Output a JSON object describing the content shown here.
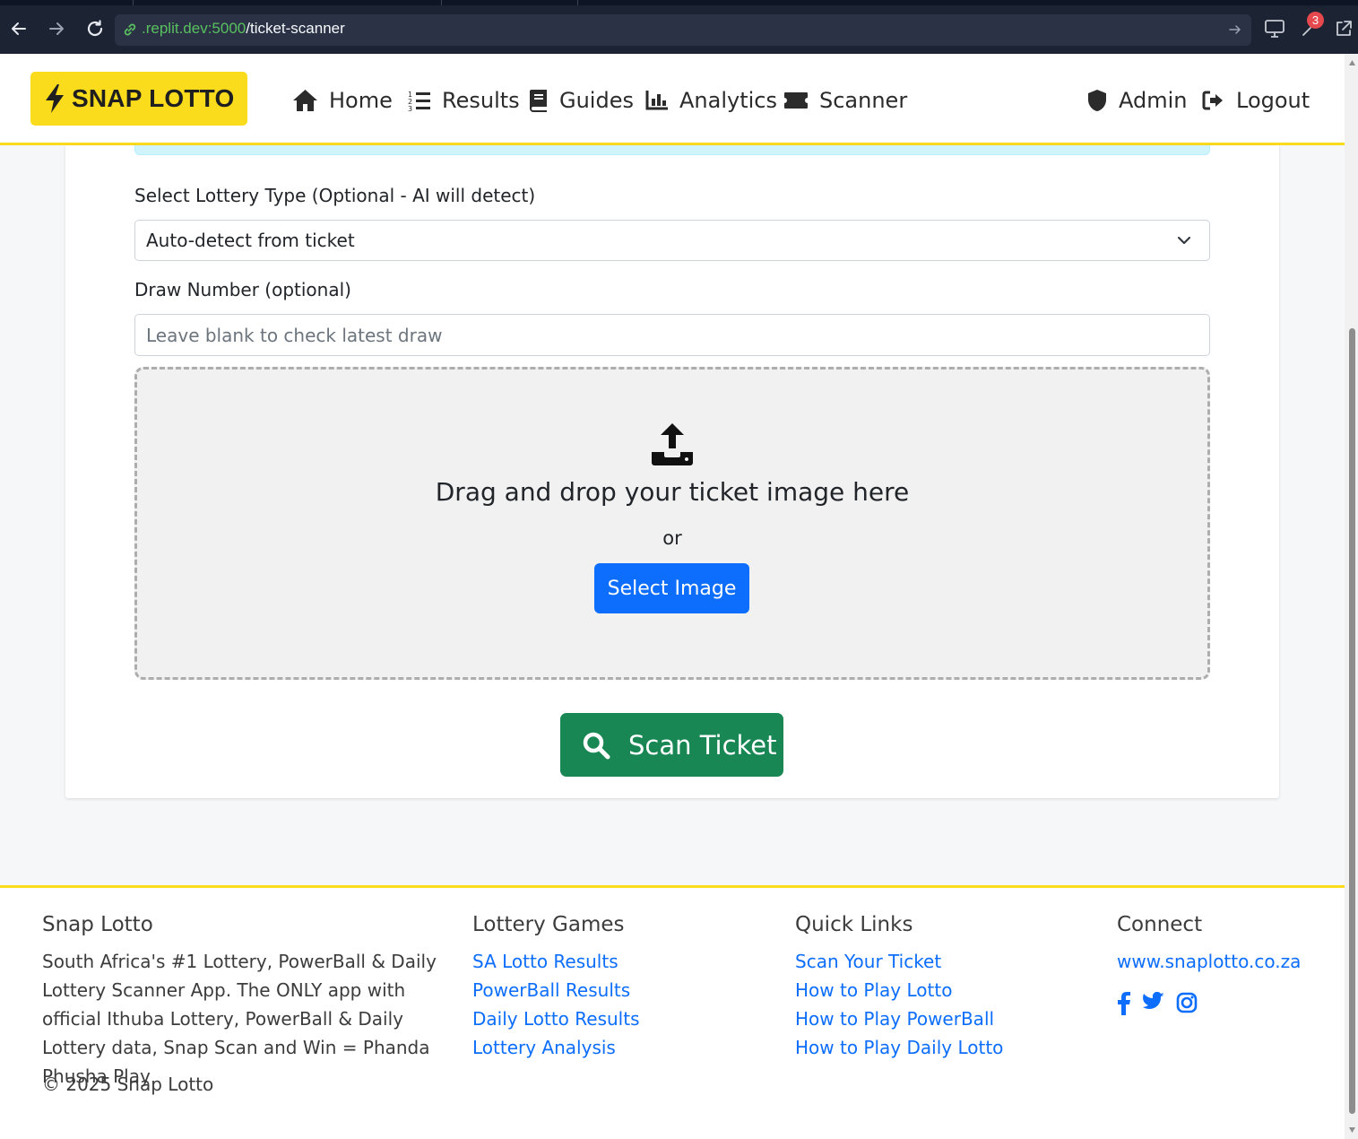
{
  "browser": {
    "url_host": ".replit.dev:5000",
    "url_path": "/ticket-scanner",
    "notification_count": "3"
  },
  "navbar": {
    "brand": "SNAP LOTTO",
    "items": [
      {
        "label": "Home",
        "icon": "home-icon"
      },
      {
        "label": "Results",
        "icon": "list-ol-icon"
      },
      {
        "label": "Guides",
        "icon": "book-icon"
      },
      {
        "label": "Analytics",
        "icon": "chart-icon"
      },
      {
        "label": "Scanner",
        "icon": "ticket-icon"
      }
    ],
    "right_items": [
      {
        "label": "Admin",
        "icon": "shield-icon"
      },
      {
        "label": "Logout",
        "icon": "logout-icon"
      }
    ]
  },
  "form": {
    "lottery_type_label": "Select Lottery Type (Optional - AI will detect)",
    "lottery_type_value": "Auto-detect from ticket",
    "draw_number_label": "Draw Number (optional)",
    "draw_number_placeholder": "Leave blank to check latest draw",
    "draw_number_value": ""
  },
  "dropzone": {
    "title": "Drag and drop your ticket image here",
    "or_text": "or",
    "select_button": "Select Image"
  },
  "scan_button": "Scan Ticket",
  "footer": {
    "about": {
      "heading": "Snap Lotto",
      "text": "South Africa's #1 Lottery, PowerBall & Daily Lottery Scanner App. The ONLY app with official Ithuba Lottery, PowerBall & Daily Lottery data, Snap Scan and Win = Phanda Phusha Play",
      "copyright": "© 2025 Snap Lotto"
    },
    "games": {
      "heading": "Lottery Games",
      "links": [
        "SA Lotto Results",
        "PowerBall Results",
        "Daily Lotto Results",
        "Lottery Analysis"
      ]
    },
    "quick": {
      "heading": "Quick Links",
      "links": [
        "Scan Your Ticket",
        "How to Play Lotto",
        "How to Play PowerBall",
        "How to Play Daily Lotto"
      ]
    },
    "connect": {
      "heading": "Connect",
      "website": "www.snaplotto.co.za",
      "social": [
        "facebook-icon",
        "twitter-icon",
        "instagram-icon"
      ]
    }
  },
  "colors": {
    "brand_yellow": "#fbdc1d",
    "primary_blue": "#0d6efd",
    "success_green": "#198754",
    "chrome_bg": "#1c2333"
  }
}
